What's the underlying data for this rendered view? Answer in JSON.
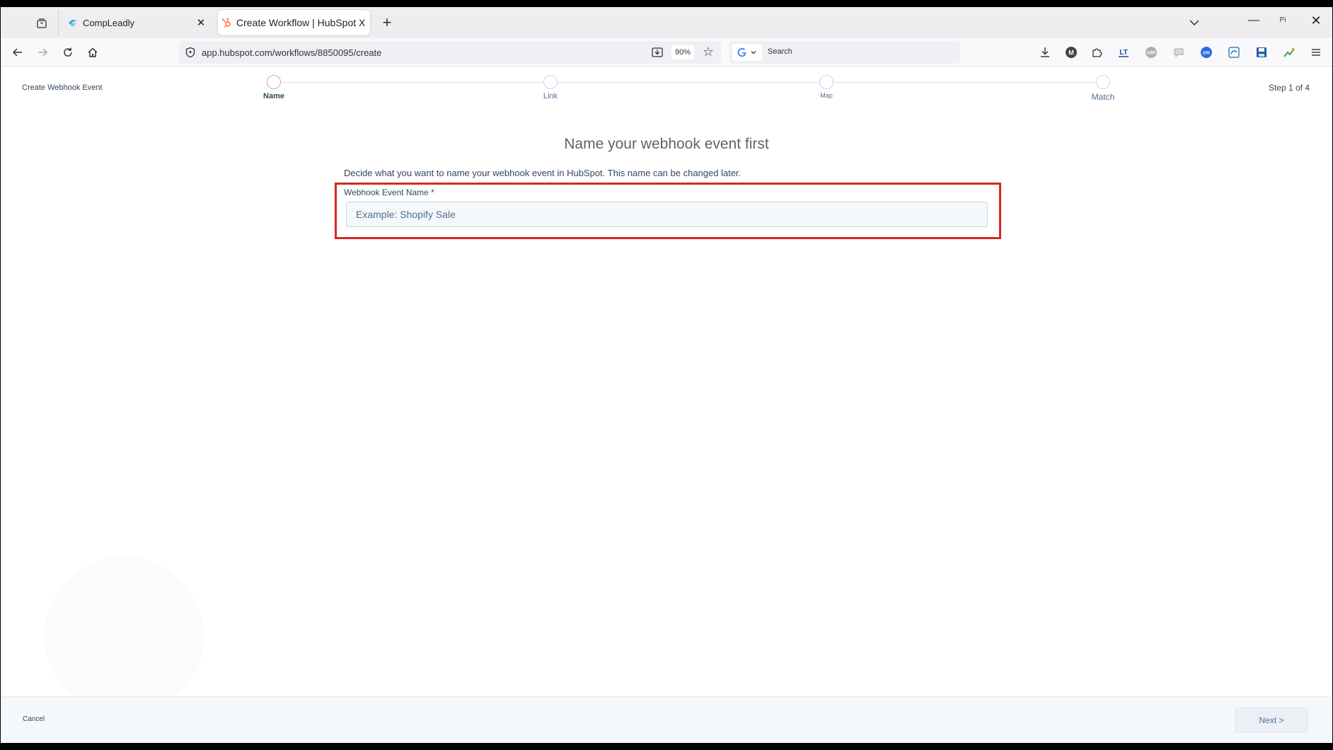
{
  "browser": {
    "tabs": [
      {
        "title": "CompLeadly",
        "active": false
      },
      {
        "title": "Create Workflow | HubSpot X",
        "active": true
      }
    ],
    "tab_close_glyph": "✕",
    "new_tab_glyph": "+",
    "url": "app.hubspot.com/workflows/8850095/create",
    "zoom": "90%",
    "search_placeholder": "Search",
    "window_user": "Pi",
    "minimize_glyph": "—",
    "close_glyph": "✕",
    "bookmark_glyph": "☆"
  },
  "wizard": {
    "title": "Create Webhook Event",
    "step_counter": "Step 1 of 4",
    "steps": [
      {
        "label": "Name",
        "active": true
      },
      {
        "label": "Link",
        "active": false
      },
      {
        "label": "Map",
        "active": false
      },
      {
        "label": "Match",
        "active": false
      }
    ],
    "heading": "Name your webhook event first",
    "description": "Decide what you want to name your webhook event in HubSpot. This name can be changed later.",
    "field": {
      "label": "Webhook Event Name *",
      "placeholder": "Example: Shopify Sale",
      "value": ""
    },
    "footer": {
      "cancel_label": "Cancel",
      "next_label": "Next >"
    }
  },
  "colors": {
    "highlight_border": "#d7281e",
    "hubspot_orange": "#ff7a59",
    "text_dark": "#33475b",
    "text_muted": "#516f90"
  }
}
